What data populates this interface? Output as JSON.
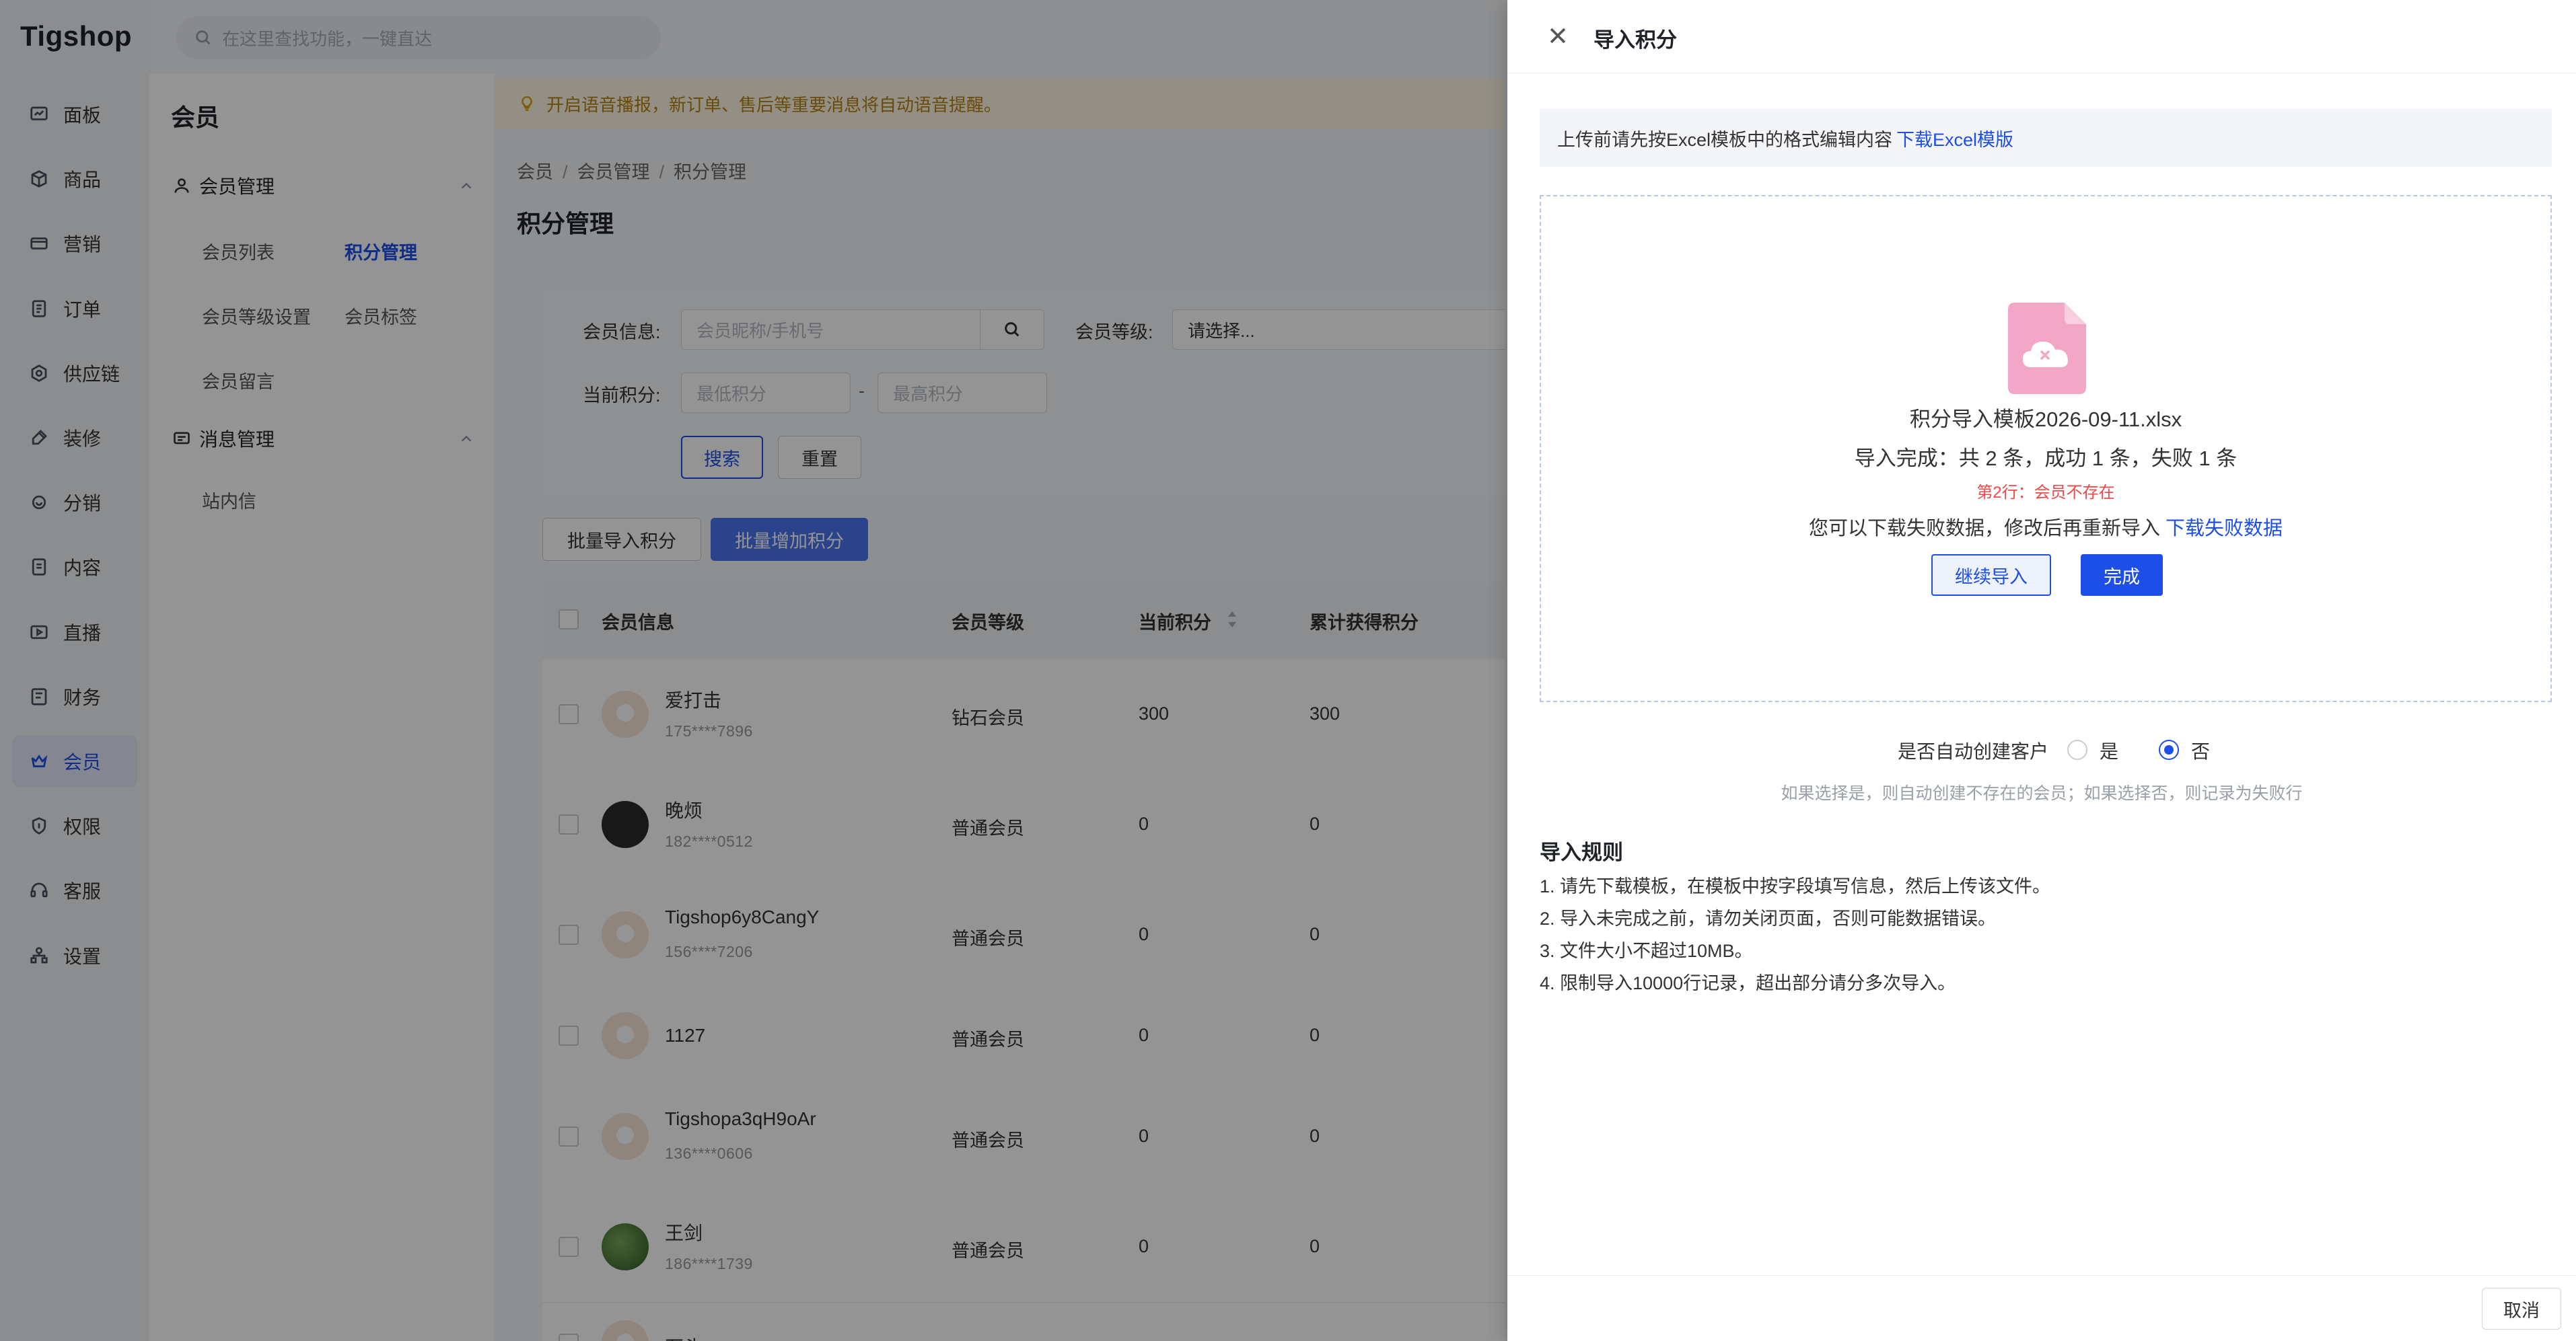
{
  "app": {
    "logo": "Tigshop"
  },
  "rail": [
    {
      "label": "面板",
      "icon": "dashboard-icon"
    },
    {
      "label": "商品",
      "icon": "box-icon"
    },
    {
      "label": "营销",
      "icon": "ticket-icon"
    },
    {
      "label": "订单",
      "icon": "order-icon"
    },
    {
      "label": "供应链",
      "icon": "cube-icon"
    },
    {
      "label": "装修",
      "icon": "brush-icon"
    },
    {
      "label": "分销",
      "icon": "share-icon"
    },
    {
      "label": "内容",
      "icon": "doc-icon"
    },
    {
      "label": "直播",
      "icon": "live-icon"
    },
    {
      "label": "财务",
      "icon": "finance-icon"
    },
    {
      "label": "会员",
      "icon": "crown-icon",
      "active": true
    },
    {
      "label": "权限",
      "icon": "shield-icon"
    },
    {
      "label": "客服",
      "icon": "headset-icon"
    },
    {
      "label": "设置",
      "icon": "org-icon"
    }
  ],
  "topsearch": {
    "placeholder": "在这里查找功能，一键直达"
  },
  "subside": {
    "title": "会员",
    "group1": "会员管理",
    "links": {
      "member_list": "会员列表",
      "points": "积分管理",
      "level": "会员等级设置",
      "tags": "会员标签",
      "messages": "会员留言"
    },
    "group2": "消息管理",
    "inbox": "站内信"
  },
  "notice": "开启语音播报，新订单、售后等重要消息将自动语音提醒。",
  "breadcrumb": [
    "会员",
    "会员管理",
    "积分管理"
  ],
  "page_title": "积分管理",
  "filter": {
    "member_label": "会员信息:",
    "member_placeholder": "会员昵称/手机号",
    "level_label": "会员等级:",
    "level_value": "请选择...",
    "points_label": "当前积分:",
    "min_placeholder": "最低积分",
    "dash": "-",
    "max_placeholder": "最高积分",
    "search": "搜索",
    "reset": "重置"
  },
  "actions": {
    "batch_import": "批量导入积分",
    "batch_add": "批量增加积分"
  },
  "table": {
    "headers": [
      "会员信息",
      "会员等级",
      "当前积分",
      "累计获得积分"
    ],
    "rows": [
      {
        "name": "爱打击",
        "phone": "175****7896",
        "level": "钻石会员",
        "points": "300",
        "total": "300",
        "avatar": "cat"
      },
      {
        "name": "晚烦",
        "phone": "182****0512",
        "level": "普通会员",
        "points": "0",
        "total": "0",
        "avatar": "boy"
      },
      {
        "name": "Tigshop6y8CangY",
        "phone": "156****7206",
        "level": "普通会员",
        "points": "0",
        "total": "0",
        "avatar": "cat"
      },
      {
        "name": "1127",
        "phone": "",
        "level": "普通会员",
        "points": "0",
        "total": "0",
        "avatar": "cat"
      },
      {
        "name": "Tigshopa3qH9oAr",
        "phone": "136****0606",
        "level": "普通会员",
        "points": "0",
        "total": "0",
        "avatar": "cat"
      },
      {
        "name": "王剑",
        "phone": "186****1739",
        "level": "普通会员",
        "points": "0",
        "total": "0",
        "avatar": "green"
      },
      {
        "name": "石头",
        "phone": "",
        "level": "",
        "points": "",
        "total": "",
        "avatar": "cat"
      }
    ]
  },
  "drawer": {
    "title": "导入积分",
    "tip": "上传前请先按Excel模板中的格式编辑内容",
    "tip_link": "下载Excel模版",
    "file_name": "积分导入模板2026-09-11.xlsx",
    "result": "导入完成：共 2 条，成功 1 条，失败 1 条",
    "error": "第2行：会员不存在",
    "fail_tip": "您可以下载失败数据，修改后再重新导入",
    "fail_link": "下载失败数据",
    "continue": "继续导入",
    "done": "完成",
    "auto_label": "是否自动创建客户",
    "yes": "是",
    "no": "否",
    "auto_selected": "否",
    "auto_hint": "如果选择是，则自动创建不存在的会员；如果选择否，则记录为失败行",
    "rules_title": "导入规则",
    "rules": [
      "1. 请先下载模板，在模板中按字段填写信息，然后上传该文件。",
      "2. 导入未完成之前，请勿关闭页面，否则可能数据错误。",
      "3. 文件大小不超过10MB。",
      "4. 限制导入10000行记录，超出部分请分多次导入。"
    ],
    "cancel": "取消"
  },
  "colors": {
    "primary": "#1d4fe8",
    "error": "#f04848",
    "notice_bg": "#fdf6e3",
    "file_icon": "#f3a7c7"
  }
}
